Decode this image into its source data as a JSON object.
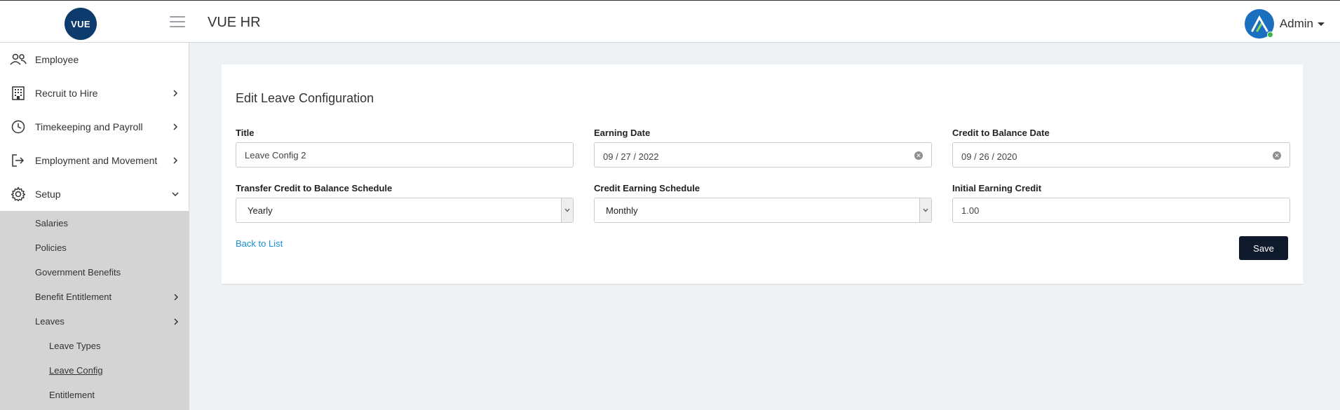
{
  "header": {
    "logo_text": "VUE",
    "app_title": "VUE HR",
    "user_name": "Admin"
  },
  "sidebar": {
    "items": [
      {
        "label": "Employee",
        "icon": "people-icon"
      },
      {
        "label": "Recruit to Hire",
        "icon": "building-icon"
      },
      {
        "label": "Timekeeping and Payroll",
        "icon": "clock-icon"
      },
      {
        "label": "Employment and Movement",
        "icon": "sign-in-icon"
      },
      {
        "label": "Setup",
        "icon": "gear-icon"
      }
    ],
    "setup_sub": [
      {
        "label": "Salaries"
      },
      {
        "label": "Policies"
      },
      {
        "label": "Government Benefits"
      },
      {
        "label": "Benefit Entitlement"
      },
      {
        "label": "Leaves"
      }
    ],
    "leaves_sub": [
      {
        "label": "Leave Types"
      },
      {
        "label": "Leave Config"
      },
      {
        "label": "Entitlement"
      }
    ]
  },
  "form": {
    "title": "Edit Leave Configuration",
    "fields": {
      "title": {
        "label": "Title",
        "value": "Leave Config 2"
      },
      "earning_date": {
        "label": "Earning Date",
        "value": "09 / 27 / 2022"
      },
      "credit_to_balance_date": {
        "label": "Credit to Balance Date",
        "value": "09 / 26 / 2020"
      },
      "transfer_schedule": {
        "label": "Transfer Credit to Balance Schedule",
        "value": "Yearly"
      },
      "earning_schedule": {
        "label": "Credit Earning Schedule",
        "value": "Monthly"
      },
      "initial_credit": {
        "label": "Initial Earning Credit",
        "value": "1.00"
      }
    },
    "back_link": "Back to List",
    "save_label": "Save"
  },
  "colors": {
    "brand": "#0d3b6e",
    "save_button": "#0e1a2b",
    "link": "#1a8fd6",
    "submenu_bg": "#d4d4d4"
  }
}
